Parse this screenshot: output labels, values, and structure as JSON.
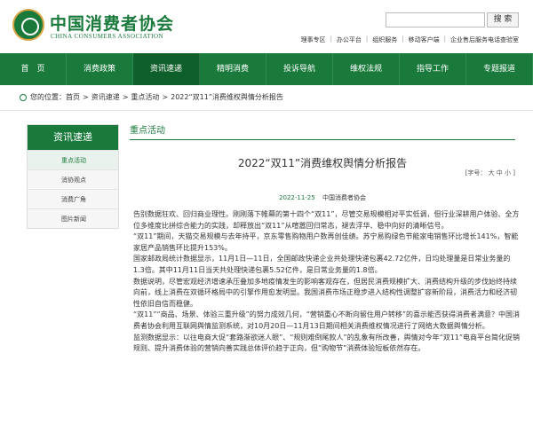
{
  "header": {
    "logo_cn": "中国消费者协会",
    "logo_en": "CHINA CONSUMERS ASSOCIATION",
    "search_button": "搜 索",
    "top_links": [
      "理事专区",
      "办公平台",
      "组织服务",
      "移动客户端",
      "企业售后服务电话查验室"
    ]
  },
  "nav": {
    "items": [
      "首　页",
      "消费政策",
      "资讯速递",
      "精明消费",
      "投诉导航",
      "维权法规",
      "指导工作",
      "专题报道"
    ],
    "active_index": 2
  },
  "breadcrumb": {
    "prefix": "您的位置：",
    "items": [
      "首页",
      "资讯速递",
      "重点活动",
      "2022“双11”消费维权舆情分析报告"
    ],
    "separator": ">"
  },
  "sidebar": {
    "title": "资讯速递",
    "items": [
      "重点活动",
      "消协观点",
      "消费广角",
      "图片新闻"
    ],
    "active_index": 0
  },
  "section": {
    "title": "重点活动"
  },
  "article": {
    "title": "2022“双11”消费维权舆情分析报告",
    "font_label": "[字号：",
    "font_sizes": [
      "大",
      "中",
      "小"
    ],
    "font_end": "]",
    "date": "2022-11-25",
    "source": "中国消费者协会",
    "paragraphs": [
      "告别数据狂欢、回归商业理性。刚刚落下帷幕的第十四个“双11”，尽管交易规模相对平实低调，但行业深耕用户体验、全方位多维度比拼综合能力的实践，却释放出“双11”从喧嚣回归常态，褪去浮华、稳中向好的清晰信号。",
      "“双11”期间，天猫交易规模与去年持平，京东零售购物用户数再创佳绩。苏宁易购绿色节能家电销售环比增长141%，智能家居产品销售环比提升153%。",
      "国家邮政局统计数据显示，11月1日—11日，全国邮政快递企业共处理快递包裹42.72亿件，日均处理量是日常业务量的1.3倍。其中11月11日当天共处理快递包裹5.52亿件，是日常业务量的1.8倍。",
      "数据说明，尽管宏观经济增速承压叠加多地疫情发生的影响客观存在，但居民消费规模扩大、消费结构升级的步伐始终持续向前，线上消费在双循环格局中的引擎作用愈发明显。我国消费市场正稳步进入结构性调整扩容新阶段，消费活力和经济韧性依旧自信而稳健。",
      "“双11”“商品、场景、体验三重升级”的努力成效几何，“营销重心不断向留住用户转移”的喜示能否获得消费者满意？中国消费者协会利用互联网舆情监测系统，对10月20日—11月13日期间相关消费维权情况进行了网络大数据舆情分析。",
      "监测数据显示：以往电商大促“套路渐欲迷人眼”、“规则难倒尾款人”的乱象有所改善，舆情对今年“双11”电商平台简化促销规则、提升消费体验的营销向善实践总体评价趋于正向，但“购物节”消费体验短板依然存在。"
    ]
  },
  "colors": {
    "brand_green": "#1a7a3c",
    "nav_active": "#0f5f2b"
  }
}
